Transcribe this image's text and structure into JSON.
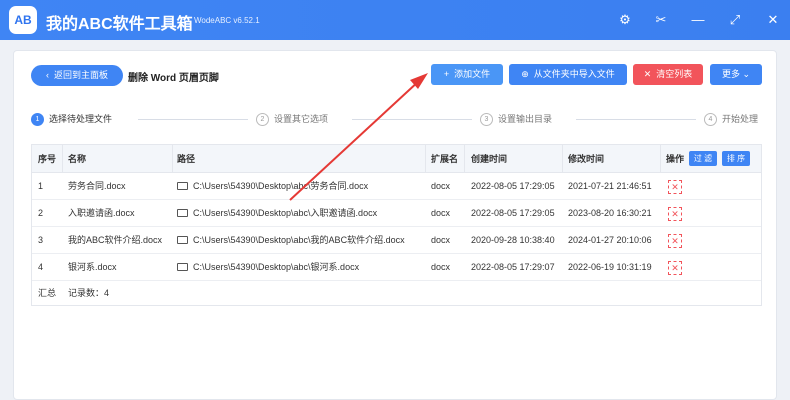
{
  "app": {
    "logo_text": "AB",
    "title": "我的ABC软件工具箱",
    "version": "WodeABC v6.52.1",
    "icons": [
      "gear-icon",
      "scissors-icon",
      "minimize-icon",
      "maximize-icon",
      "close-icon"
    ]
  },
  "toolbar": {
    "back_label": "返回到主面板",
    "page_title": "删除 Word 页眉页脚",
    "add_file_label": "添加文件",
    "import_folder_label": "从文件夹中导入文件",
    "clear_label": "清空列表",
    "more_label": "更多"
  },
  "steps": [
    {
      "num": "1",
      "label": "选择待处理文件",
      "active": true
    },
    {
      "num": "2",
      "label": "设置其它选项",
      "active": false
    },
    {
      "num": "3",
      "label": "设置输出目录",
      "active": false
    },
    {
      "num": "4",
      "label": "开始处理",
      "active": false
    }
  ],
  "table": {
    "headers": {
      "index": "序号",
      "name": "名称",
      "path": "路径",
      "ext": "扩展名",
      "created": "创建时间",
      "modified": "修改时间",
      "action": "操作",
      "filter_label": "过 滤",
      "sort_label": "排 序"
    },
    "rows": [
      {
        "index": "1",
        "name": "劳务合同.docx",
        "path": "C:\\Users\\54390\\Desktop\\abc\\劳务合同.docx",
        "ext": "docx",
        "created": "2022-08-05 17:29:05",
        "modified": "2021-07-21 21:46:51"
      },
      {
        "index": "2",
        "name": "入职邀请函.docx",
        "path": "C:\\Users\\54390\\Desktop\\abc\\入职邀请函.docx",
        "ext": "docx",
        "created": "2022-08-05 17:29:05",
        "modified": "2023-08-20 16:30:21"
      },
      {
        "index": "3",
        "name": "我的ABC软件介绍.docx",
        "path": "C:\\Users\\54390\\Desktop\\abc\\我的ABC软件介绍.docx",
        "ext": "docx",
        "created": "2020-09-28 10:38:40",
        "modified": "2024-01-27 20:10:06"
      },
      {
        "index": "4",
        "name": "银河系.docx",
        "path": "C:\\Users\\54390\\Desktop\\abc\\银河系.docx",
        "ext": "docx",
        "created": "2022-08-05 17:29:07",
        "modified": "2022-06-19 10:31:19"
      }
    ],
    "footer": {
      "summary_label": "汇总",
      "count_text": "记录数：4"
    }
  },
  "colors": {
    "primary": "#3f85f4",
    "danger": "#f2545b",
    "annotation_arrow": "#e53935"
  }
}
